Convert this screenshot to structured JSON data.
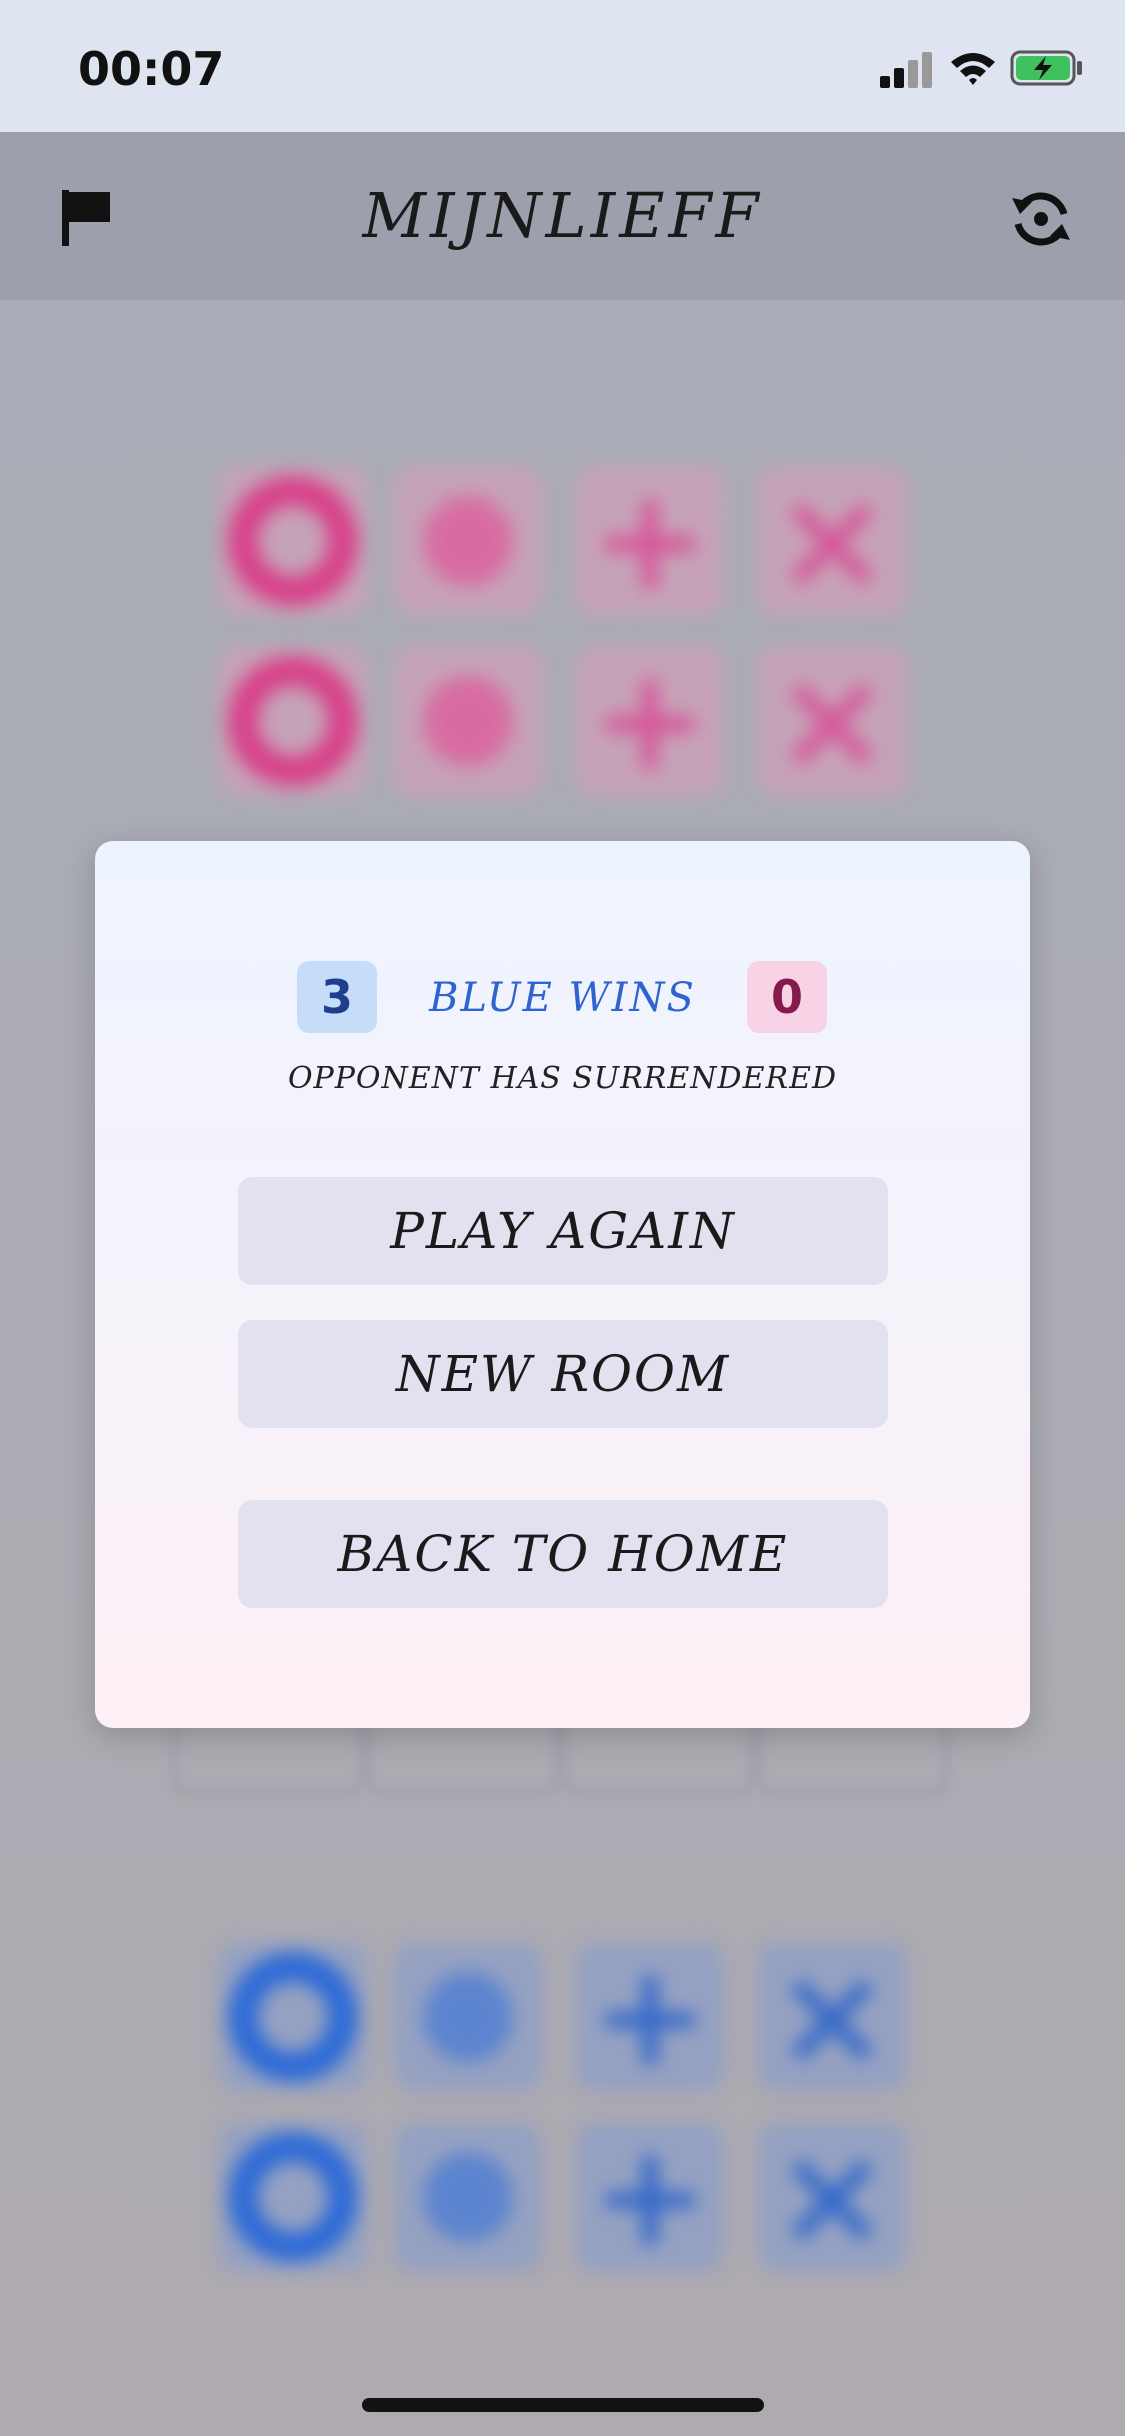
{
  "status_bar": {
    "time": "00:07"
  },
  "header": {
    "title": "MIJNLIEFF",
    "left_icon": "flag-icon",
    "right_icon": "refresh-icon"
  },
  "board": {
    "top_pieces": [
      "ring",
      "dot",
      "plus",
      "cross",
      "ring",
      "dot",
      "plus",
      "cross"
    ],
    "bottom_pieces": [
      "ring",
      "dot",
      "plus",
      "cross",
      "ring",
      "dot",
      "plus",
      "cross"
    ],
    "top_color": "#d8418a",
    "bottom_color": "#2d6ad6"
  },
  "modal": {
    "blue_score": "3",
    "result": "BLUE WINS",
    "pink_score": "0",
    "subtitle": "OPPONENT HAS SURRENDERED",
    "buttons": {
      "play_again": "PLAY AGAIN",
      "new_room": "NEW ROOM",
      "back_home": "BACK TO HOME"
    }
  }
}
